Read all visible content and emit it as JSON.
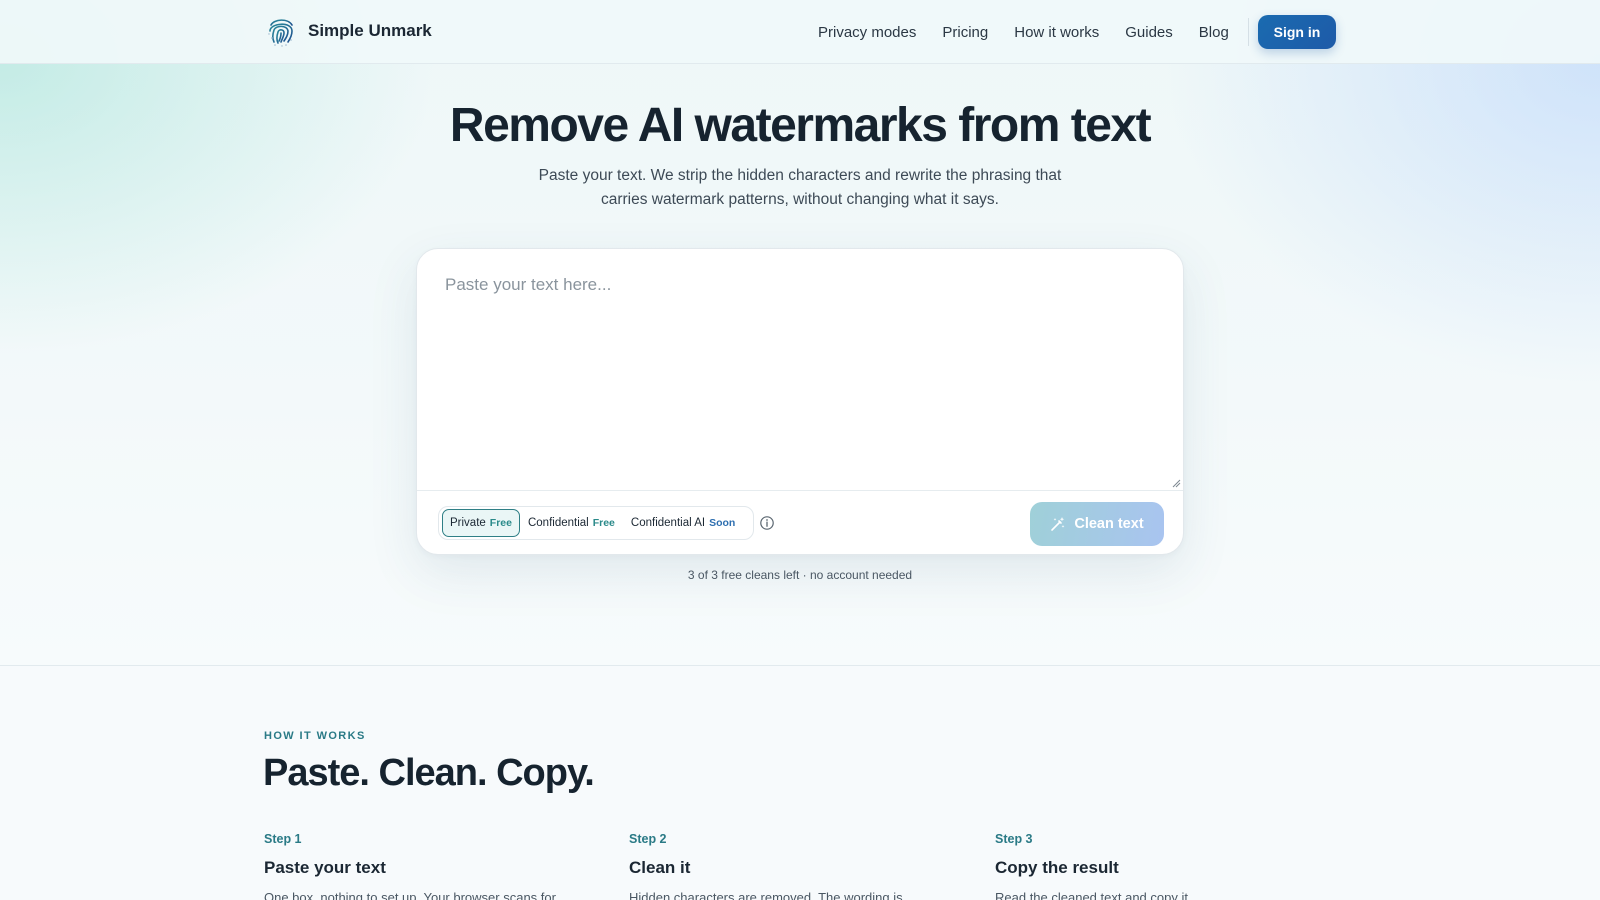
{
  "brand": {
    "name": "Simple Unmark",
    "logo_icon": "fingerprint-icon"
  },
  "nav": {
    "items": [
      "Privacy modes",
      "Pricing",
      "How it works",
      "Guides",
      "Blog"
    ],
    "signin_label": "Sign in"
  },
  "hero": {
    "title": "Remove AI watermarks from text",
    "subtitle_line1": "Paste your text. We strip the hidden characters and rewrite the phrasing that",
    "subtitle_line2": "carries watermark patterns, without changing what it says."
  },
  "editor": {
    "placeholder": "Paste your text here...",
    "modes": [
      {
        "label": "Private",
        "badge": "Free",
        "active": true
      },
      {
        "label": "Confidential",
        "badge": "Free",
        "active": false
      },
      {
        "label": "Confidential AI",
        "badge": "Soon",
        "active": false
      }
    ],
    "info_icon": "info-icon",
    "clean_label": "Clean text",
    "clean_icon": "magic-wand-icon"
  },
  "quota_text": "3 of 3 free cleans left · no account needed",
  "how_it_works": {
    "kicker": "HOW IT WORKS",
    "title": "Paste. Clean. Copy.",
    "steps": [
      {
        "label": "Step 1",
        "title": "Paste your text",
        "desc": "One box, nothing to set up. Your browser scans for"
      },
      {
        "label": "Step 2",
        "title": "Clean it",
        "desc": "Hidden characters are removed. The wording is"
      },
      {
        "label": "Step 3",
        "title": "Copy the result",
        "desc": "Read the cleaned text and copy it."
      }
    ]
  },
  "colors": {
    "accent_teal": "#2a7a86",
    "signin_blue": "#1e5aa8",
    "text_dark": "#16232f"
  }
}
